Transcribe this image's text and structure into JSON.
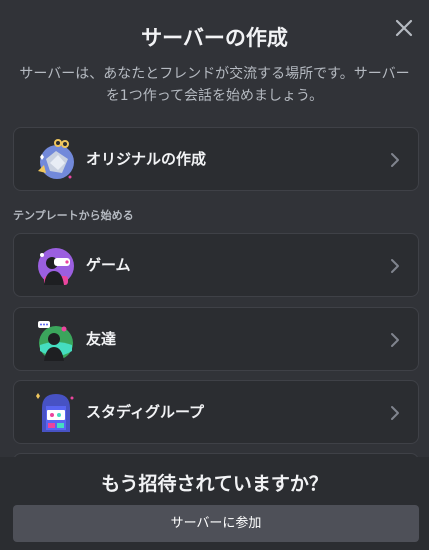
{
  "modal": {
    "title": "サーバーの作成",
    "subtitle": "サーバーは、あなたとフレンドが交流する場所です。サーバーを1つ作って会話を始めましょう。"
  },
  "options": {
    "create_own": {
      "label": "オリジナルの作成",
      "icon": "create-own-server-icon"
    },
    "section_label": "テンプレートから始める",
    "templates": [
      {
        "label": "ゲーム",
        "icon": "gaming-icon"
      },
      {
        "label": "友達",
        "icon": "friends-icon"
      },
      {
        "label": "スタディグループ",
        "icon": "study-group-icon"
      }
    ]
  },
  "footer": {
    "title": "もう招待されていますか？",
    "join_button": "サーバーに参加"
  },
  "colors": {
    "background": "#313338",
    "card": "#2b2d31",
    "button": "#4e5058"
  }
}
